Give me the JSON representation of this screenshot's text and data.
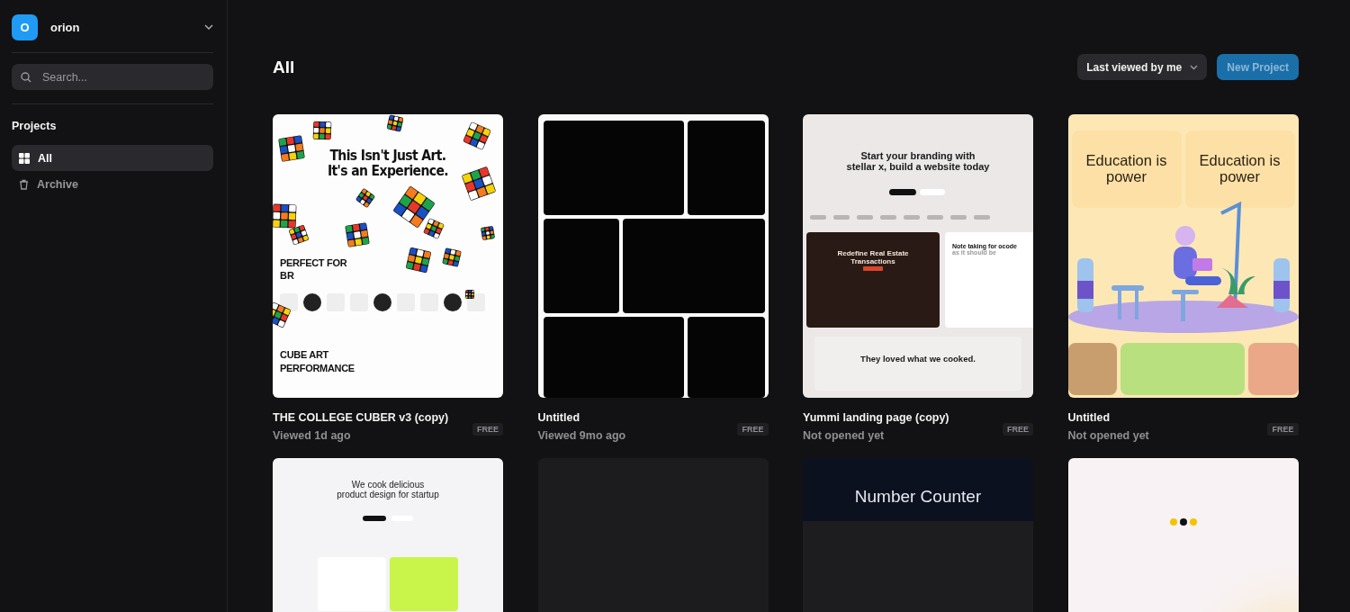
{
  "workspace": {
    "avatar": "O",
    "name": "orion"
  },
  "search": {
    "placeholder": "Search..."
  },
  "sidebar": {
    "heading": "Projects",
    "items": [
      {
        "label": "All",
        "kind": "grid",
        "selected": true
      },
      {
        "label": "Archive",
        "kind": "trash",
        "selected": false
      }
    ]
  },
  "header": {
    "title": "All",
    "sort": "Last viewed by me",
    "new_button": "New Project"
  },
  "projects": [
    {
      "title": "THE COLLEGE CUBER v3 (copy)",
      "subtitle": "Viewed 1d ago",
      "badge": "FREE",
      "thumb": {
        "kind": "cube",
        "texts": [
          "This Isn't Just Art.",
          "It's an Experience.",
          "PERFECT FOR",
          "BR",
          "CUBE ART",
          "PERFORMANCE"
        ]
      }
    },
    {
      "title": "Untitled",
      "subtitle": "Viewed 9mo ago",
      "badge": "FREE",
      "thumb": {
        "kind": "grid"
      }
    },
    {
      "title": "Yummi landing page (copy)",
      "subtitle": "Not opened yet",
      "badge": "FREE",
      "thumb": {
        "kind": "landing",
        "texts": [
          "Start your branding with",
          "stellar x, build a website today",
          "Redefine Real Estate Transactions",
          "Note taking for ocode",
          "as it should be",
          "They loved what we cooked."
        ]
      }
    },
    {
      "title": "Untitled",
      "subtitle": "Not opened yet",
      "badge": "FREE",
      "thumb": {
        "kind": "education",
        "texts": [
          "Education is power",
          "Education is power"
        ]
      }
    },
    {
      "thumb": {
        "kind": "startup",
        "texts": [
          "We cook delicious",
          "product design for startup"
        ]
      }
    },
    {
      "thumb": {
        "kind": "empty"
      }
    },
    {
      "thumb": {
        "kind": "counter",
        "texts": [
          "Number Counter"
        ]
      }
    },
    {
      "thumb": {
        "kind": "loader"
      }
    }
  ]
}
